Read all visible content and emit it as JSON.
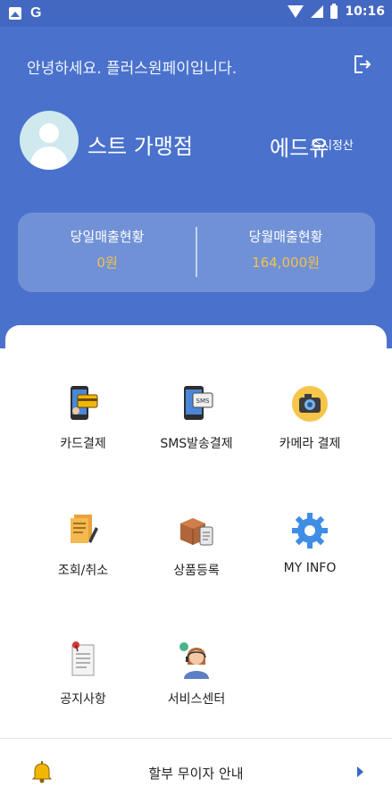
{
  "status_bar": {
    "time": "10:16",
    "left_icons": [
      "gallery-icon",
      "g-icon"
    ],
    "right_icons": [
      "wifi-icon",
      "signal-icon",
      "battery-icon"
    ],
    "g_glyph": "G"
  },
  "header": {
    "greeting": "안녕하세요. 플러스원페이입니다.",
    "store_name": "스트 가맹점",
    "edu_text": "에드유",
    "instant_text": "즉시정산",
    "logout_icon": "logout-icon",
    "bg_color": "#4a72cc"
  },
  "sales": {
    "daily": {
      "label": "당일매출현황",
      "value": "0원"
    },
    "monthly": {
      "label": "당월매출현황",
      "value": "164,000원"
    },
    "value_color": "#f1c24a"
  },
  "menu": {
    "items": [
      {
        "label": "카드결제",
        "icon": "card-payment-icon"
      },
      {
        "label": "SMS발송결제",
        "icon": "sms-payment-icon"
      },
      {
        "label": "카메라 결제",
        "icon": "camera-payment-icon"
      },
      {
        "label": "조회/취소",
        "icon": "lookup-cancel-icon"
      },
      {
        "label": "상품등록",
        "icon": "product-register-icon"
      },
      {
        "label": "MY INFO",
        "icon": "gear-icon"
      },
      {
        "label": "공지사항",
        "icon": "notice-icon"
      },
      {
        "label": "서비스센터",
        "icon": "service-center-icon"
      }
    ],
    "sms_icon_text": "SMS"
  },
  "bottom_bar": {
    "text": "할부 무이자 안내",
    "icon": "bell-icon",
    "chevron_icon": "chevron-right-icon",
    "accent": "#3a66c8"
  }
}
